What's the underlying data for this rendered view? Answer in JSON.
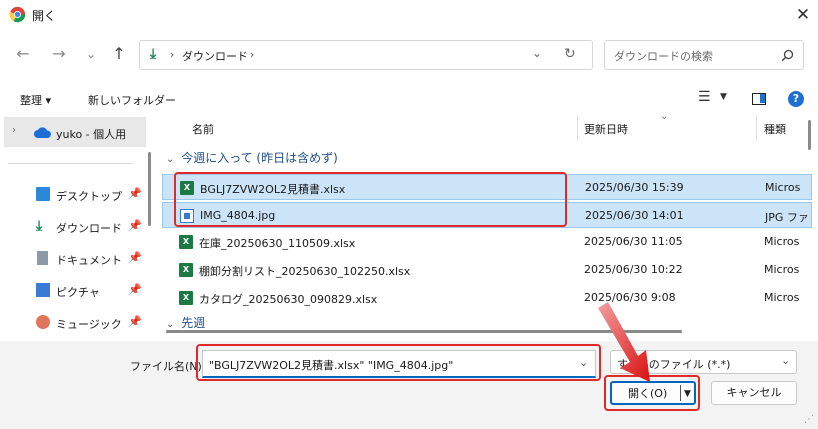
{
  "window": {
    "title": "開く"
  },
  "nav": {
    "back": "←",
    "forward": "→",
    "dropdown": "⌄",
    "up": "↑",
    "address": {
      "location": "ダウンロード",
      "sep": "›"
    },
    "search": {
      "placeholder": "ダウンロードの検索"
    }
  },
  "toolbar": {
    "organize": "整理 ▾",
    "new_folder": "新しいフォルダー"
  },
  "sidebar": {
    "top_item": "yuko - 個人用",
    "items": [
      {
        "label": "デスクトップ",
        "pin": "📌"
      },
      {
        "label": "ダウンロード",
        "pin": "📌"
      },
      {
        "label": "ドキュメント",
        "pin": "📌"
      },
      {
        "label": "ピクチャ",
        "pin": "📌"
      },
      {
        "label": "ミュージック",
        "pin": "📌"
      }
    ]
  },
  "columns": {
    "name": "名前",
    "date": "更新日時",
    "type": "種類"
  },
  "groups": {
    "this_week": "今週に入って (昨日は含めず)",
    "last_week": "先週"
  },
  "files": [
    {
      "name": "BGLJ7ZVW2OL2見積書.xlsx",
      "date": "2025/06/30 15:39",
      "type": "Micros",
      "icon": "excel-icon",
      "selected": true
    },
    {
      "name": "IMG_4804.jpg",
      "date": "2025/06/30 14:01",
      "type": "JPG ファ",
      "icon": "jpg-icon",
      "selected": true
    },
    {
      "name": "在庫_20250630_110509.xlsx",
      "date": "2025/06/30 11:05",
      "type": "Micros",
      "icon": "excel-icon",
      "selected": false
    },
    {
      "name": "棚卸分割リスト_20250630_102250.xlsx",
      "date": "2025/06/30 10:22",
      "type": "Micros",
      "icon": "excel-icon",
      "selected": false
    },
    {
      "name": "カタログ_20250630_090829.xlsx",
      "date": "2025/06/30 9:08",
      "type": "Micros",
      "icon": "excel-icon",
      "selected": false
    }
  ],
  "footer": {
    "filename_label": "ファイル名(N):",
    "filename_value": "\"BGLJ7ZVW2OL2見積書.xlsx\" \"IMG_4804.jpg\"",
    "filter_value": "すべてのファイル (*.*)",
    "open_label": "開く(O)",
    "cancel_label": "キャンセル"
  },
  "colors": {
    "accent": "#0067c0",
    "highlight": "#e02a2a",
    "selection": "#cce4f7"
  }
}
